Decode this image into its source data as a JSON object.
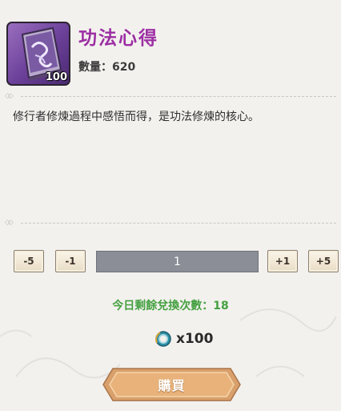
{
  "item": {
    "name": "功法心得",
    "icon": "scroll-book-icon",
    "stack_count": "100",
    "count_label": "數量：",
    "count_value": "620",
    "description": "修行者修煉過程中感悟而得，是功法修煉的核心。"
  },
  "quantity": {
    "minus5_label": "-5",
    "minus1_label": "-1",
    "value": "1",
    "plus1_label": "+1",
    "plus5_label": "+5"
  },
  "remaining_text": "今日剩餘兌換次數：18",
  "price": {
    "icon": "jade-coin-icon",
    "amount": "x100"
  },
  "buy_label": "購買",
  "colors": {
    "item_name": "#9c2fa3",
    "remaining": "#44a040",
    "quantity_bar": "#8b8e96",
    "buy_button": "#e2a86a"
  }
}
